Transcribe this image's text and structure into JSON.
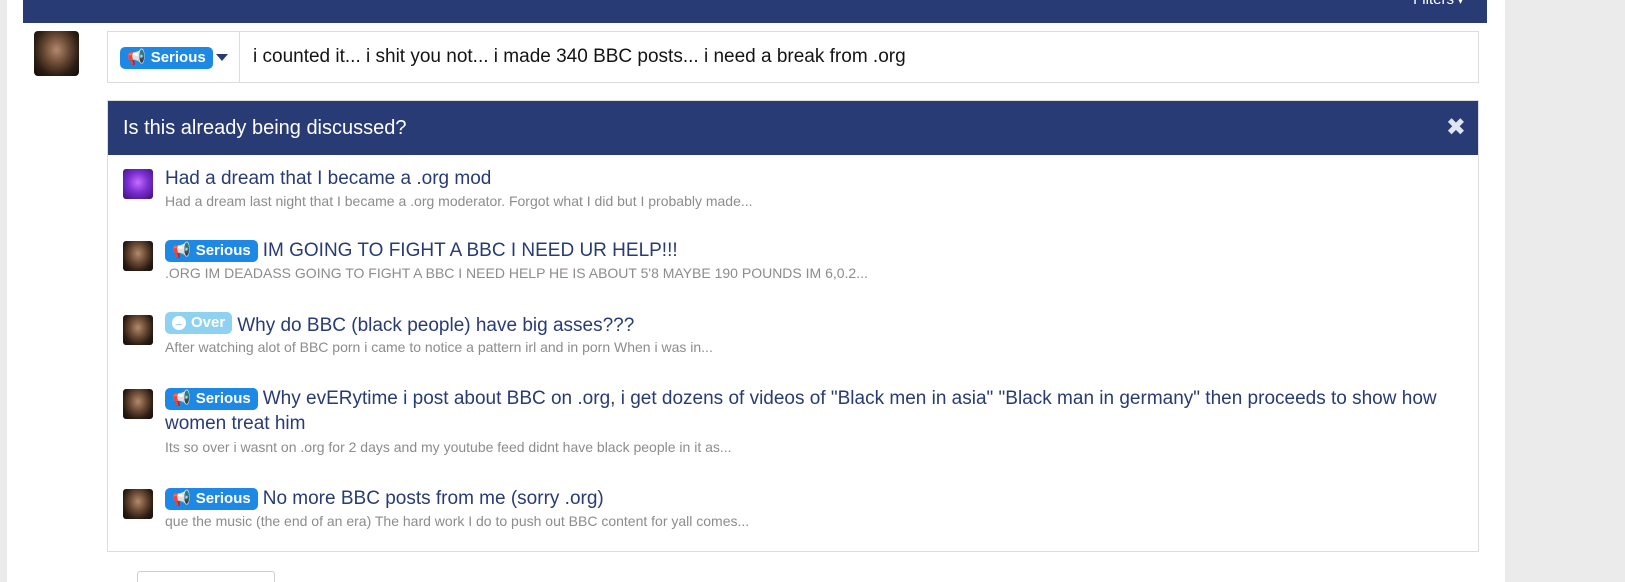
{
  "topbar": {
    "filters_label": "Filters",
    "filters_caret": "▾"
  },
  "composer": {
    "prefix": {
      "label": "Serious",
      "icon": "megaphone-icon"
    },
    "title_value": "i counted it... i shit you not... i made 340 BBC posts... i need a break from .org"
  },
  "similar": {
    "heading": "Is this already being discussed?",
    "close_glyph": "✖",
    "threads": [
      {
        "prefix": "",
        "title": "Had a dream that I became a .org mod",
        "snippet": "Had a dream last night that I became a .org moderator. Forgot what I did but I probably made..."
      },
      {
        "prefix": "Serious",
        "title": "IM GOING TO FIGHT A BBC I NEED UR HELP!!!",
        "snippet": ".ORG IM DEADASS GOING TO FIGHT A BBC I NEED HELP HE IS ABOUT 5'8 MAYBE 190 POUNDS IM 6,0.2..."
      },
      {
        "prefix": "Over",
        "title": "Why do BBC (black people) have big asses???",
        "snippet": "After watching alot of BBC porn i came to notice a pattern irl and in porn When i was in..."
      },
      {
        "prefix": "Serious",
        "title": "Why evERytime i post about BBC on .org, i get dozens of videos of \"Black men in asia\" \"Black man in germany\" then proceeds to show how women treat him",
        "snippet": "Its so over i wasnt on .org for 2 days and my youtube feed didnt have black people in it as..."
      },
      {
        "prefix": "Serious",
        "title": "No more BBC posts from me (sorry .org)",
        "snippet": "que the music (the end of an era) The hard work I do to push out BBC content for yall comes..."
      }
    ]
  },
  "colors": {
    "header_navy": "#283b74",
    "serious_badge": "#1e88e5",
    "over_badge": "#8fd1f0",
    "link": "#283b74",
    "snippet": "#8c8c8c"
  }
}
